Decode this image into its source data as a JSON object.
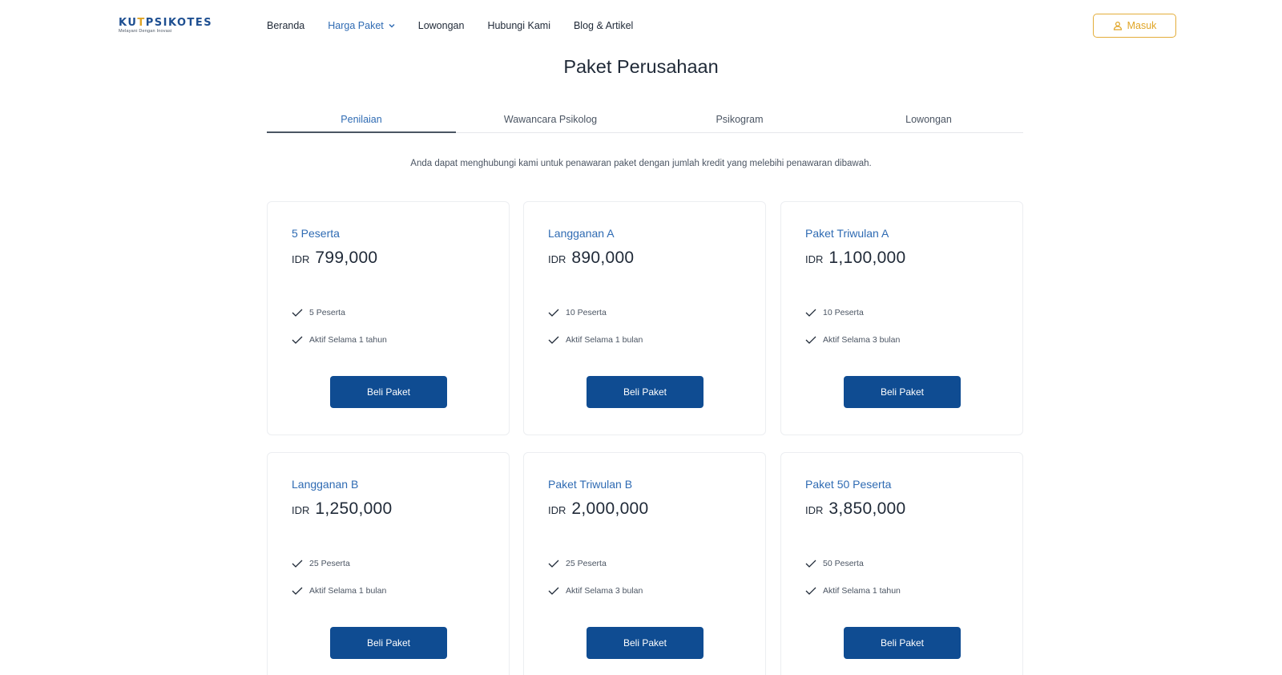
{
  "brand": {
    "name_prefix": "KU",
    "name_accent": "T",
    "name_suffix": "PSIKOTES",
    "tagline": "Melayani Dengan Inovasi"
  },
  "nav": {
    "items": [
      "Beranda",
      "Harga Paket",
      "Lowongan",
      "Hubungi Kami",
      "Blog & Artikel"
    ],
    "active": "Harga Paket"
  },
  "login": {
    "label": "Masuk"
  },
  "page": {
    "title": "Paket Perusahaan",
    "subtitle": "Anda dapat menghubungi kami untuk penawaran paket dengan jumlah kredit yang melebihi penawaran dibawah."
  },
  "tabs": {
    "items": [
      "Penilaian",
      "Wawancara Psikolog",
      "Psikogram",
      "Lowongan"
    ],
    "active": "Penilaian"
  },
  "packages": [
    {
      "name": "5 Peserta",
      "currency": "IDR",
      "price": "799,000",
      "features": [
        "5 Peserta",
        "Aktif Selama 1 tahun"
      ],
      "button": "Beli Paket"
    },
    {
      "name": "Langganan A",
      "currency": "IDR",
      "price": "890,000",
      "features": [
        "10 Peserta",
        "Aktif Selama 1 bulan"
      ],
      "button": "Beli Paket"
    },
    {
      "name": "Paket Triwulan A",
      "currency": "IDR",
      "price": "1,100,000",
      "features": [
        "10 Peserta",
        "Aktif Selama 3 bulan"
      ],
      "button": "Beli Paket"
    },
    {
      "name": "Langganan B",
      "currency": "IDR",
      "price": "1,250,000",
      "features": [
        "25 Peserta",
        "Aktif Selama 1 bulan"
      ],
      "button": "Beli Paket"
    },
    {
      "name": "Paket Triwulan B",
      "currency": "IDR",
      "price": "2,000,000",
      "features": [
        "25 Peserta",
        "Aktif Selama 3 bulan"
      ],
      "button": "Beli Paket"
    },
    {
      "name": "Paket 50 Peserta",
      "currency": "IDR",
      "price": "3,850,000",
      "features": [
        "50 Peserta",
        "Aktif Selama 1 tahun"
      ],
      "button": "Beli Paket"
    }
  ],
  "colors": {
    "primary": "#0f4c92",
    "link": "#2f6bb3",
    "accent": "#e0a526"
  },
  "icons": {
    "logo": "paperclip-logo-icon",
    "nav_dropdown": "chevron-down-icon",
    "login": "user-icon",
    "feature": "check-icon"
  }
}
